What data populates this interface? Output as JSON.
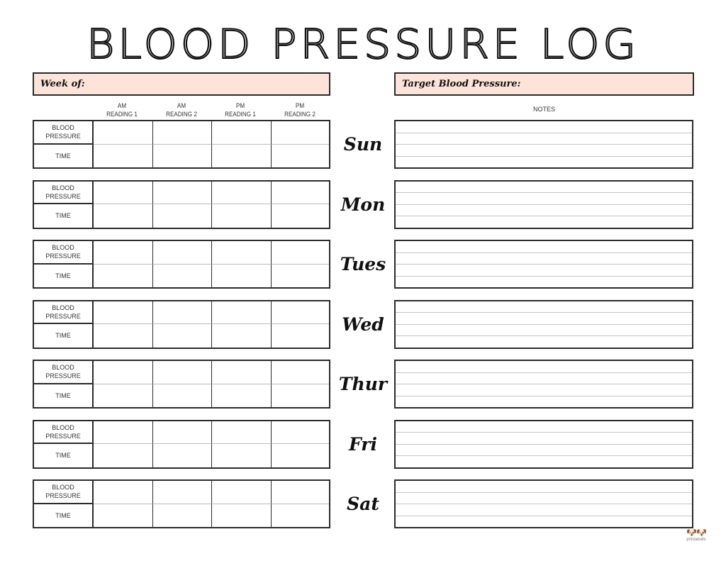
{
  "page_title": "BLOOD PRESSURE LOG",
  "header": {
    "week_of_label": "Week of:",
    "target_label": "Target Blood Pressure:"
  },
  "columns": [
    {
      "line1": "AM",
      "line2": "READING 1"
    },
    {
      "line1": "AM",
      "line2": "READING 2"
    },
    {
      "line1": "PM",
      "line2": "READING 1"
    },
    {
      "line1": "PM",
      "line2": "READING 2"
    }
  ],
  "notes_label": "NOTES",
  "row_labels": {
    "blood_pressure_line1": "BLOOD",
    "blood_pressure_line2": "PRESSURE",
    "time": "TIME"
  },
  "days": [
    {
      "label": "Sun"
    },
    {
      "label": "Mon"
    },
    {
      "label": "Tues"
    },
    {
      "label": "Wed"
    },
    {
      "label": "Thur"
    },
    {
      "label": "Fri"
    },
    {
      "label": "Sat"
    }
  ],
  "colors": {
    "header_fill": "#fde3d8",
    "border": "#2b2b2b",
    "rule_line": "#c4c4c4"
  },
  "brand": {
    "icon": "dog-heads-icon",
    "text": "printabulls"
  }
}
